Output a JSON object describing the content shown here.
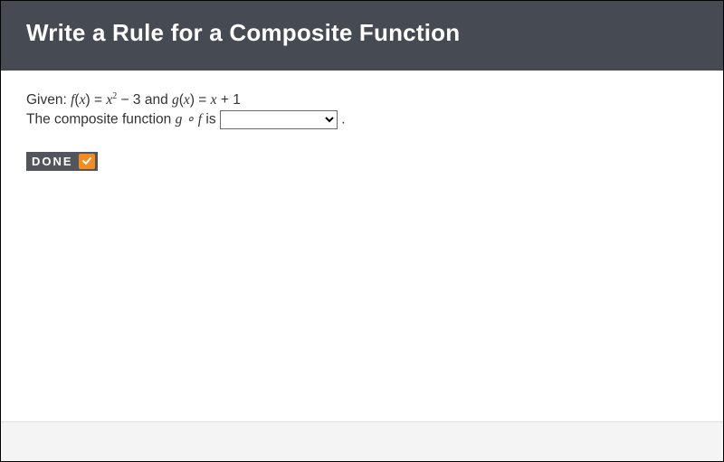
{
  "header": {
    "title": "Write a Rule for a Composite Function"
  },
  "problem": {
    "given_prefix": "Given: ",
    "f_label": "f",
    "open_paren": "(",
    "var_x": "x",
    "close_paren": ")",
    "equals": " = ",
    "x_squared": "x",
    "squared_exp": "2",
    "minus3": " − 3",
    "and_word": " and ",
    "g_label": "g",
    "g_rhs": " + 1",
    "line2_prefix": "The composite function ",
    "comp_g": "g",
    "comp_circle": " ∘ ",
    "comp_f": "f",
    "is_word": " is ",
    "period": "."
  },
  "controls": {
    "answer_select_value": "",
    "done_label": "DONE"
  },
  "icons": {
    "done_check": "check-icon"
  },
  "colors": {
    "header_bg": "#464a52",
    "accent_orange": "#f28c1e",
    "footer_bg": "#f4f4f4"
  }
}
